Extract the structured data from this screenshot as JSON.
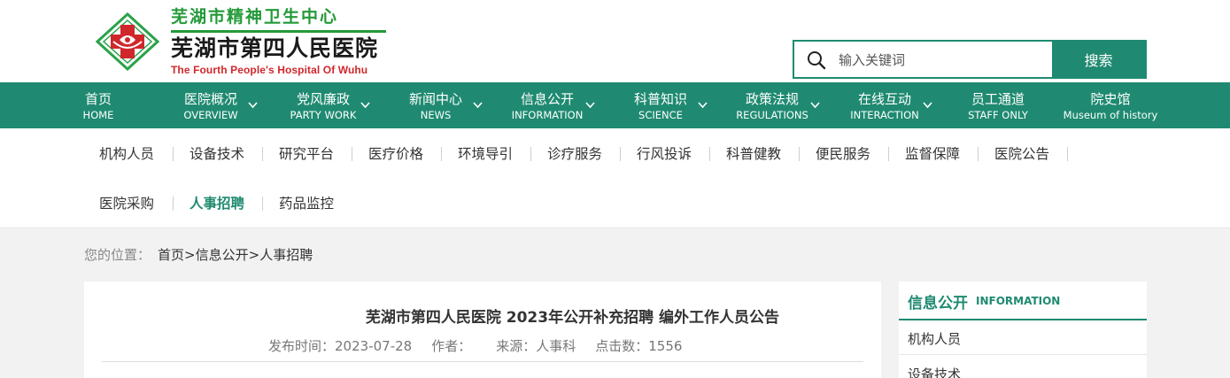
{
  "header": {
    "logo_line1": "芜湖市精神卫生中心",
    "logo_line2": "芜湖市第四人民医院",
    "logo_line3": "The Fourth People's Hospital Of Wuhu",
    "logo_icon": "hospital-cross-logo-icon"
  },
  "search": {
    "placeholder": "输入关键词",
    "button_label": "搜索",
    "icon": "search-icon"
  },
  "nav": {
    "items": [
      {
        "cn": "首页",
        "en": "HOME",
        "dropdown": false
      },
      {
        "cn": "医院概况",
        "en": "OVERVIEW",
        "dropdown": true
      },
      {
        "cn": "党风廉政",
        "en": "PARTY WORK",
        "dropdown": true
      },
      {
        "cn": "新闻中心",
        "en": "NEWS",
        "dropdown": true
      },
      {
        "cn": "信息公开",
        "en": "INFORMATION",
        "dropdown": true
      },
      {
        "cn": "科普知识",
        "en": "SCIENCE",
        "dropdown": true
      },
      {
        "cn": "政策法规",
        "en": "REGULATIONS",
        "dropdown": true
      },
      {
        "cn": "在线互动",
        "en": "INTERACTION",
        "dropdown": true
      },
      {
        "cn": "员工通道",
        "en": "STAFF ONLY",
        "dropdown": false
      },
      {
        "cn": "院史馆",
        "en": "Museum of history",
        "dropdown": false
      }
    ]
  },
  "subnav": {
    "items": [
      "机构人员",
      "设备技术",
      "研究平台",
      "医疗价格",
      "环境导引",
      "诊疗服务",
      "行风投诉",
      "科普健教",
      "便民服务",
      "监督保障",
      "医院公告",
      "医院采购",
      "人事招聘",
      "药品监控"
    ],
    "active": "人事招聘"
  },
  "breadcrumb": {
    "label": "您的位置：",
    "home": "首页",
    "sep1": ">",
    "section": "信息公开",
    "sep2": ">",
    "current": "人事招聘"
  },
  "article": {
    "title": "芜湖市第四人民医院 2023年公开补充招聘 编外工作人员公告",
    "published_label": "发布时间：",
    "published_value": "2023-07-28",
    "author_label": "作者：",
    "author_value": "",
    "source_label": "来源：",
    "source_value": "人事科",
    "clicks_label": "点击数：",
    "clicks_value": "1556"
  },
  "sidebar": {
    "title": "信息公开",
    "title_en": "INFORMATION",
    "items": [
      "机构人员",
      "设备技术"
    ]
  },
  "colors": {
    "brand_green": "#1f8a71",
    "logo_green": "#239a38",
    "logo_red": "#d0272c"
  }
}
